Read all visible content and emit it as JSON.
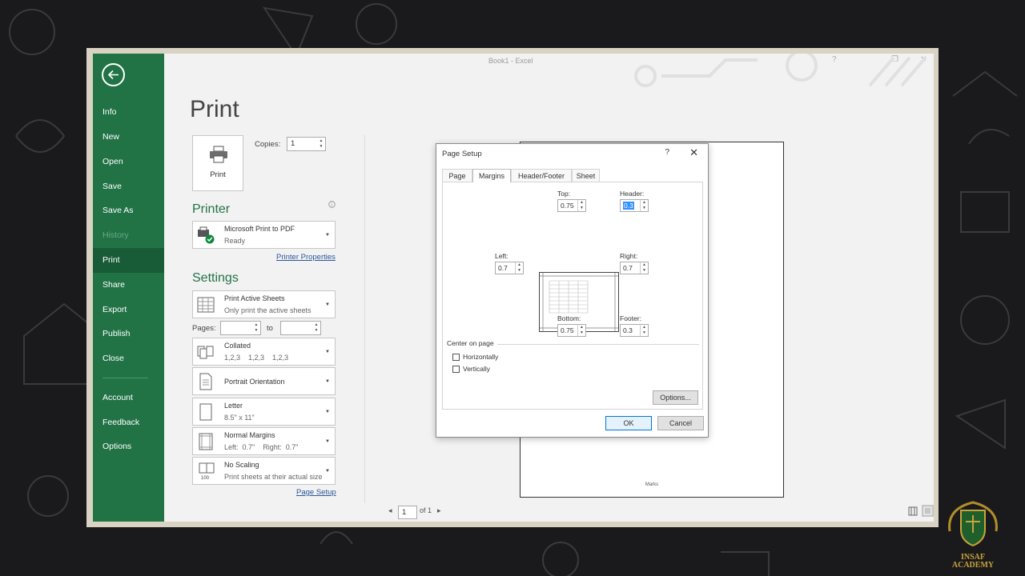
{
  "window": {
    "title": "Book1 - Excel",
    "help": "?",
    "restore": "❐",
    "close": "✕"
  },
  "nav": {
    "items": [
      {
        "label": "Info"
      },
      {
        "label": "New"
      },
      {
        "label": "Open"
      },
      {
        "label": "Save"
      },
      {
        "label": "Save As"
      },
      {
        "label": "History"
      },
      {
        "label": "Print"
      },
      {
        "label": "Share"
      },
      {
        "label": "Export"
      },
      {
        "label": "Publish"
      },
      {
        "label": "Close"
      }
    ],
    "bottom": [
      {
        "label": "Account"
      },
      {
        "label": "Feedback"
      },
      {
        "label": "Options"
      }
    ]
  },
  "print": {
    "title": "Print",
    "button_label": "Print",
    "copies_label": "Copies:",
    "copies_value": "1",
    "printer_heading": "Printer",
    "printer_name": "Microsoft Print to PDF",
    "printer_status": "Ready",
    "printer_properties": "Printer Properties",
    "settings_heading": "Settings",
    "settings": {
      "what": {
        "line1": "Print Active Sheets",
        "line2": "Only print the active sheets"
      },
      "pages_label": "Pages:",
      "pages_to": "to",
      "collate": {
        "line1": "Collated",
        "line2": "1,2,3    1,2,3    1,2,3"
      },
      "orientation": {
        "line1": "Portrait Orientation"
      },
      "paper": {
        "line1": "Letter",
        "line2": "8.5\" x 11\""
      },
      "margins": {
        "line1": "Normal Margins",
        "line2": "Left:  0.7\"    Right:  0.7\""
      },
      "scaling": {
        "line1": "No Scaling",
        "line2": "Print sheets at their actual size"
      }
    },
    "page_setup_link": "Page Setup"
  },
  "preview": {
    "footer_text": "Marks",
    "page_current": "1",
    "page_total": "of 1"
  },
  "dialog": {
    "title": "Page Setup",
    "help": "?",
    "close": "✕",
    "tabs": [
      {
        "label": "Page"
      },
      {
        "label": "Margins"
      },
      {
        "label": "Header/Footer"
      },
      {
        "label": "Sheet"
      }
    ],
    "fields": {
      "top": {
        "label": "Top:",
        "value": "0.75"
      },
      "header": {
        "label": "Header:",
        "value": "0.3"
      },
      "left": {
        "label": "Left:",
        "value": "0.7"
      },
      "right": {
        "label": "Right:",
        "value": "0.7"
      },
      "bottom": {
        "label": "Bottom:",
        "value": "0.75"
      },
      "footer": {
        "label": "Footer:",
        "value": "0.3"
      }
    },
    "center_heading": "Center on page",
    "horizontally": "Horizontally",
    "vertically": "Vertically",
    "options_button": "Options...",
    "ok_button": "OK",
    "cancel_button": "Cancel"
  },
  "brand": {
    "line1": "INSAF",
    "line2": "ACADEMY"
  },
  "colors": {
    "excel_green": "#217346",
    "active_nav": "#185c37",
    "link_blue": "#2b579a"
  }
}
